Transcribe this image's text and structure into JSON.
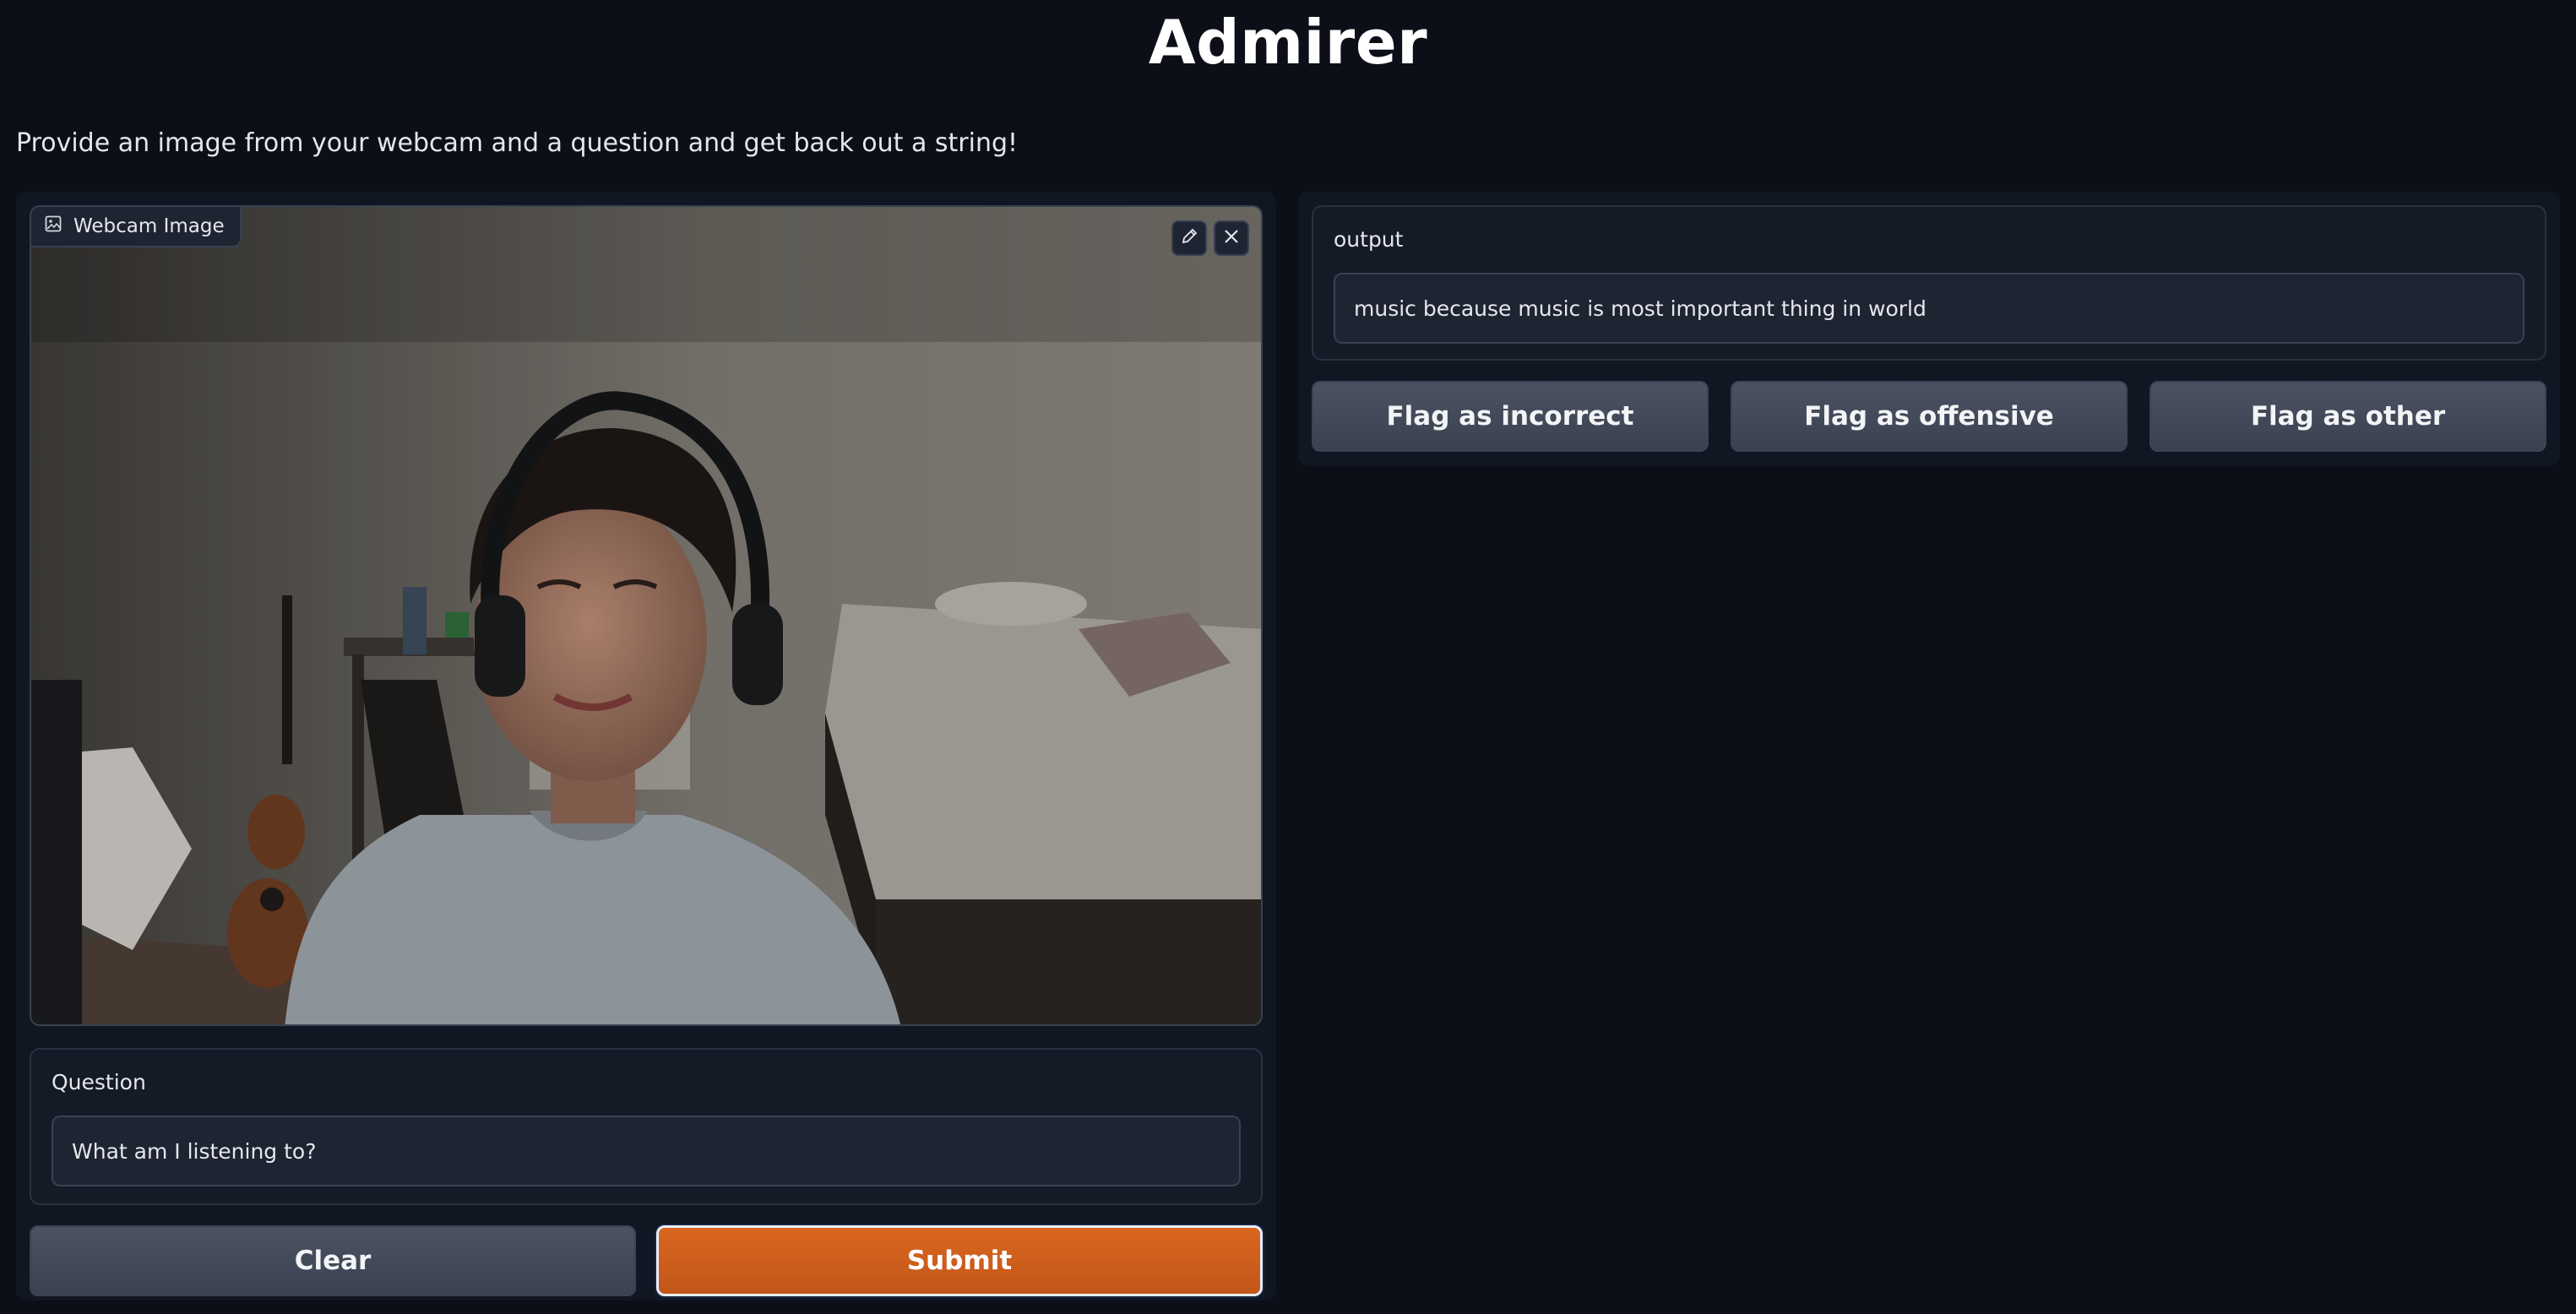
{
  "app": {
    "title": "Admirer",
    "description": "Provide an image from your webcam and a question and get back out a string!"
  },
  "image_input": {
    "label": "Webcam Image",
    "icons": {
      "label_icon": "image-icon",
      "edit": "pencil-icon",
      "clear": "close-icon"
    }
  },
  "question": {
    "label": "Question",
    "value": "What am I listening to?"
  },
  "actions": {
    "clear_label": "Clear",
    "submit_label": "Submit"
  },
  "output": {
    "label": "output",
    "value": "music because music is most important thing in world"
  },
  "flags": {
    "incorrect": "Flag as incorrect",
    "offensive": "Flag as offensive",
    "other": "Flag as other"
  },
  "colors": {
    "background": "#0c0f18",
    "panel": "#111623",
    "accent": "#c95b1c",
    "button": "#444b5a"
  }
}
